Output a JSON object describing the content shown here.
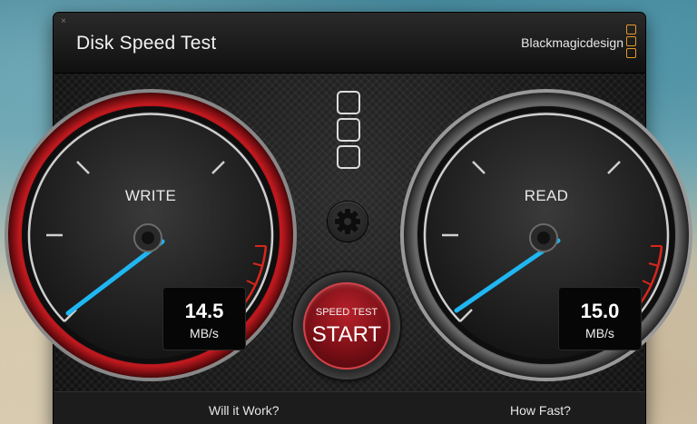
{
  "window": {
    "title": "Disk Speed Test",
    "brand": "Blackmagicdesign",
    "close_glyph": "×"
  },
  "gauges": {
    "write": {
      "label": "WRITE",
      "value": "14.5",
      "unit": "MB/s",
      "ring_color": "#b3151b"
    },
    "read": {
      "label": "READ",
      "value": "15.0",
      "unit": "MB/s",
      "ring_color": "#9a9a9a"
    }
  },
  "controls": {
    "settings_icon": "gear-icon",
    "start": {
      "top": "SPEED TEST",
      "main": "START"
    }
  },
  "footer": {
    "left": "Will it Work?",
    "right": "How Fast?"
  },
  "colors": {
    "needle": "#1fb6f2",
    "redzone": "#d8261c",
    "brand_logo": "#e39a25"
  }
}
